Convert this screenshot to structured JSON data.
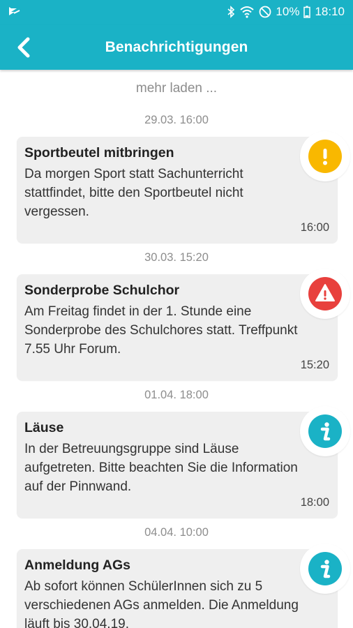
{
  "status_bar": {
    "battery": "10%",
    "time": "18:10"
  },
  "app_bar": {
    "title": "Benachrichtigungen",
    "back_icon": "chevron-left-icon"
  },
  "load_more": "mehr laden ...",
  "colors": {
    "accent": "#1ab2c6",
    "warning": "#f9b800",
    "alert": "#e8403d",
    "info": "#1ab2c6"
  },
  "notifications": [
    {
      "date_header": "29.03. 16:00",
      "title": "Sportbeutel mitbringen",
      "body": "Da morgen Sport statt Sachunterricht stattfindet, bitte den Sportbeutel nicht vergessen.",
      "time": "16:00",
      "icon": "exclamation-icon",
      "color": "#f9b800"
    },
    {
      "date_header": "30.03. 15:20",
      "title": "Sonderprobe Schulchor",
      "body": "Am Freitag findet in der 1. Stunde eine Sonderprobe des Schulchores statt. Treffpunkt 7.55 Uhr Forum.",
      "time": "15:20",
      "icon": "warning-triangle-icon",
      "color": "#e8403d"
    },
    {
      "date_header": "01.04. 18:00",
      "title": "Läuse",
      "body": "In der Betreuungsgruppe sind Läuse aufgetreten. Bitte beachten Sie die Information auf der Pinnwand.",
      "time": "18:00",
      "icon": "info-icon",
      "color": "#1ab2c6"
    },
    {
      "date_header": "04.04. 10:00",
      "title": "Anmeldung AGs",
      "body": "Ab sofort können SchülerInnen sich zu 5 verschiedenen AGs anmelden. Die Anmeldung läuft bis 30.04.19.",
      "time": "",
      "icon": "info-icon",
      "color": "#1ab2c6"
    }
  ]
}
